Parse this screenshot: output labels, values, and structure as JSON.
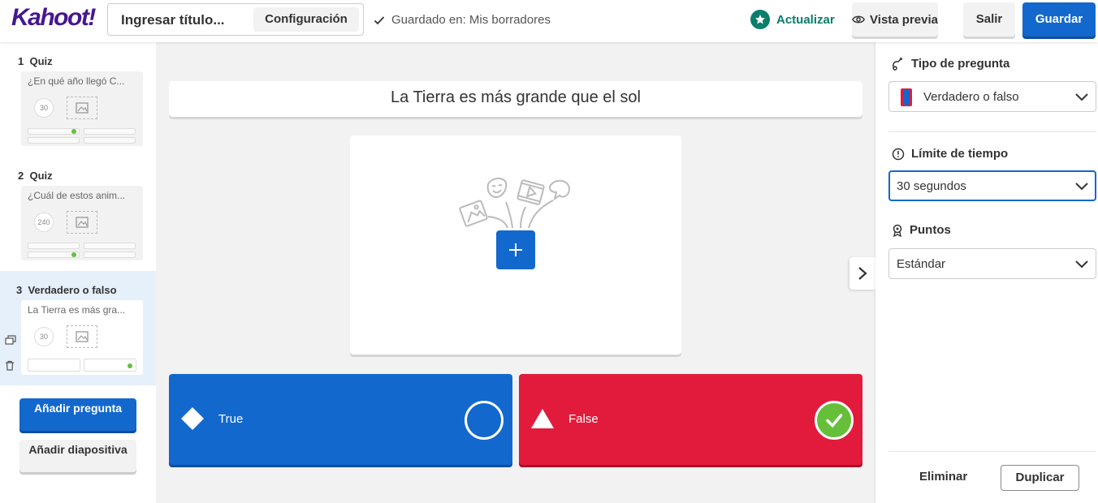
{
  "header": {
    "logo": "Kahoot!",
    "title_placeholder": "Ingresar título...",
    "settings_label": "Configuración",
    "saved_status": "Guardado en: Mis borradores",
    "upgrade_label": "Actualizar",
    "preview_label": "Vista previa",
    "exit_label": "Salir",
    "save_label": "Guardar"
  },
  "sidebar": {
    "slides": [
      {
        "number": "1",
        "type": "Quiz",
        "question": "¿En qué año llegó C...",
        "timer": "30",
        "active": false
      },
      {
        "number": "2",
        "type": "Quiz",
        "question": "¿Cuál de estos anim...",
        "timer": "240",
        "active": false
      },
      {
        "number": "3",
        "type": "Verdadero o falso",
        "question": "La Tierra es más gra...",
        "timer": "30",
        "active": true
      }
    ],
    "add_question_label": "Añadir pregunta",
    "add_slide_label": "Añadir diapositiva"
  },
  "editor": {
    "question_text": "La Tierra es más grande que el sol",
    "answers": [
      {
        "label": "True",
        "shape": "diamond-icon",
        "color": "#1368ce",
        "correct": false
      },
      {
        "label": "False",
        "shape": "triangle-icon",
        "color": "#e21b3c",
        "correct": true
      }
    ]
  },
  "panel": {
    "question_type_label": "Tipo de pregunta",
    "question_type_value": "Verdadero o falso",
    "time_limit_label": "Límite de tiempo",
    "time_limit_value": "30 segundos",
    "points_label": "Puntos",
    "points_value": "Estándar",
    "delete_label": "Eliminar",
    "duplicate_label": "Duplicar"
  },
  "colors": {
    "brand_purple": "#46178f",
    "primary_blue": "#1368ce",
    "answer_red": "#e21b3c",
    "correct_green": "#66bf39",
    "upgrade_teal": "#0a7d6b"
  }
}
